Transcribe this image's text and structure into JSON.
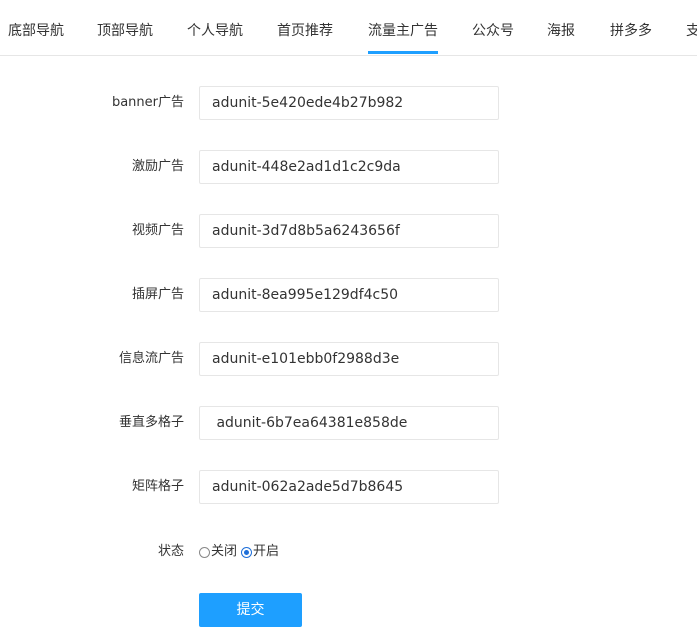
{
  "tabs": [
    {
      "label": "底部导航"
    },
    {
      "label": "顶部导航"
    },
    {
      "label": "个人导航"
    },
    {
      "label": "首页推荐"
    },
    {
      "label": "流量主广告",
      "active": true
    },
    {
      "label": "公众号"
    },
    {
      "label": "海报"
    },
    {
      "label": "拼多多"
    },
    {
      "label": "支"
    }
  ],
  "form": {
    "fields": [
      {
        "label": "banner广告",
        "value": "adunit-5e420ede4b27b982"
      },
      {
        "label": "激励广告",
        "value": "adunit-448e2ad1d1c2c9da"
      },
      {
        "label": "视频广告",
        "value": "adunit-3d7d8b5a6243656f"
      },
      {
        "label": "插屏广告",
        "value": "adunit-8ea995e129df4c50"
      },
      {
        "label": "信息流广告",
        "value": "adunit-e101ebb0f2988d3e"
      },
      {
        "label": "垂直多格子",
        "value": " adunit-6b7ea64381e858de"
      },
      {
        "label": "矩阵格子",
        "value": "adunit-062a2ade5d7b8645"
      }
    ],
    "status": {
      "label": "状态",
      "options": [
        {
          "label": "关闭",
          "checked": false
        },
        {
          "label": "开启",
          "checked": true
        }
      ]
    },
    "submit_label": "提交"
  },
  "colors": {
    "accent": "#1e9fff",
    "border": "#e6e6e6"
  }
}
